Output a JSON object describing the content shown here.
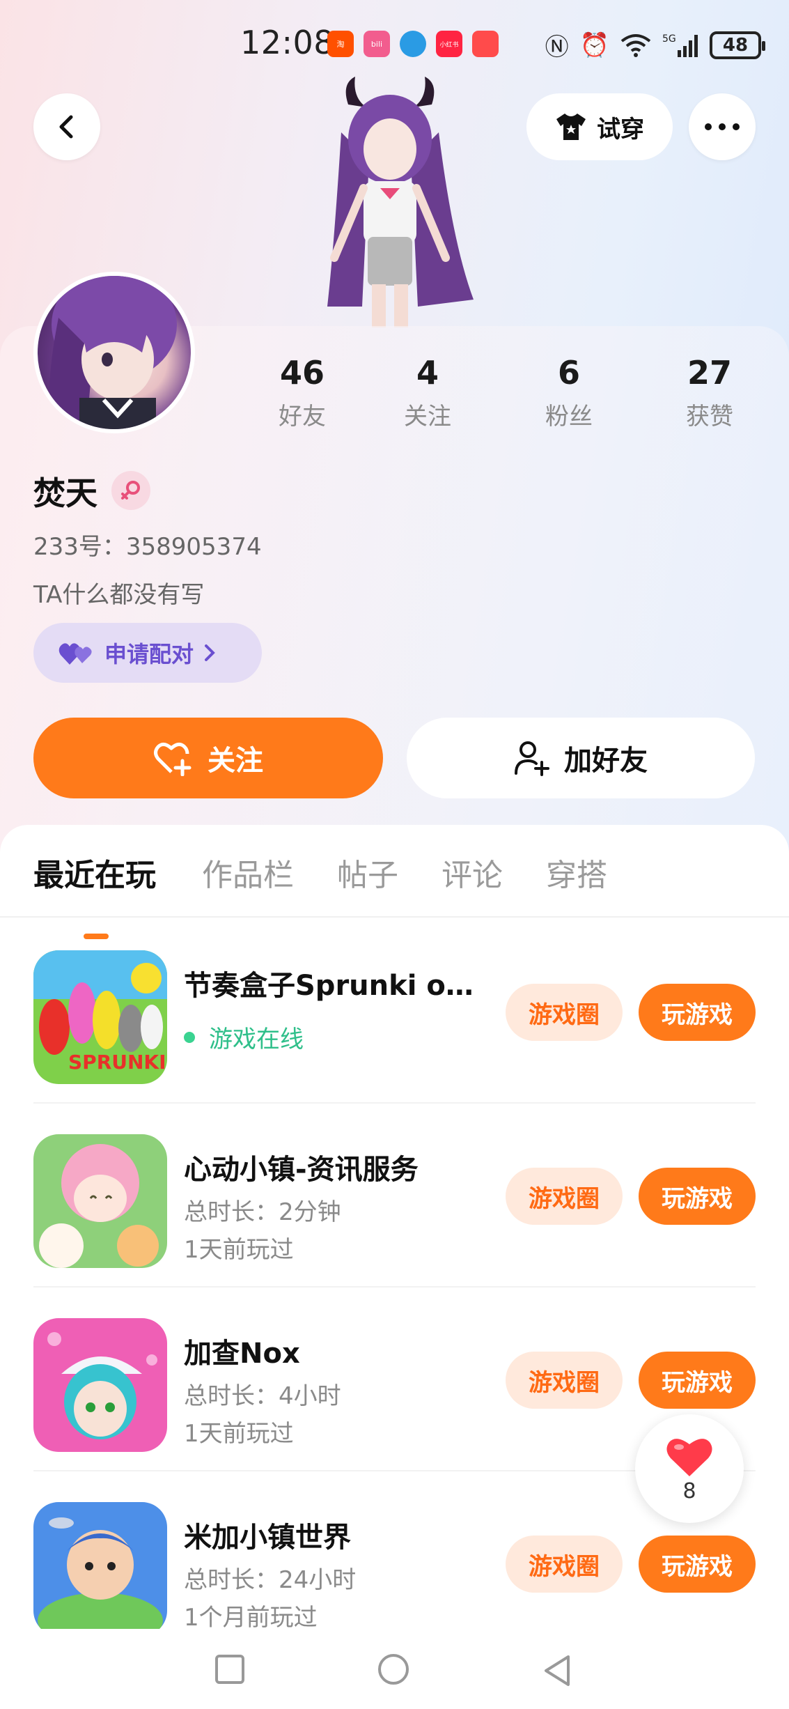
{
  "status_bar": {
    "time": "12:08",
    "apps": [
      {
        "icon": "taobao-app-icon",
        "color": "#ff5000",
        "text": "淘"
      },
      {
        "icon": "bilibili-app-icon",
        "color": "#f25d8e",
        "text": "bili"
      },
      {
        "icon": "circle-app-icon",
        "color": "#2a9be4",
        "text": ""
      },
      {
        "icon": "xiaohongshu-app-icon",
        "color": "#ff2442",
        "text": "小红书"
      },
      {
        "icon": "huawei-app-icon",
        "color": "#ff4b4b",
        "text": ""
      }
    ],
    "battery": "48"
  },
  "header": {
    "try_on_label": "试穿"
  },
  "profile": {
    "stats": [
      {
        "value": "46",
        "label": "好友"
      },
      {
        "value": "4",
        "label": "关注"
      },
      {
        "value": "6",
        "label": "粉丝"
      },
      {
        "value": "27",
        "label": "获赞"
      }
    ],
    "name": "焚天",
    "gender_symbol": "⚲",
    "uid": "233号：358905374",
    "bio": "TA什么都没有写",
    "pair_label": "申请配对"
  },
  "actions": {
    "follow_label": "关注",
    "add_friend_label": "加好友"
  },
  "tabs": [
    "最近在玩",
    "作品栏",
    "帖子",
    "评论",
    "穿搭"
  ],
  "games": [
    {
      "title": "节奏盒子Sprunki op...",
      "status": "游戏在线",
      "online": true,
      "line1": "",
      "line2": "",
      "circle_label": "游戏圈",
      "play_label": "玩游戏"
    },
    {
      "title": "心动小镇-资讯服务",
      "online": false,
      "line1": "总时长：2分钟",
      "line2": "1天前玩过",
      "circle_label": "游戏圈",
      "play_label": "玩游戏"
    },
    {
      "title": "加查Nox",
      "online": false,
      "line1": "总时长：4小时",
      "line2": "1天前玩过",
      "circle_label": "游戏圈",
      "play_label": "玩游戏"
    },
    {
      "title": "米加小镇世界",
      "online": false,
      "line1": "总时长：24小时",
      "line2": "1个月前玩过",
      "circle_label": "游戏圈",
      "play_label": "玩游戏"
    }
  ],
  "like_button": {
    "count": "8"
  },
  "colors": {
    "accent": "#ff7a1a",
    "online": "#2fbf8a",
    "pair": "#6a4fd0"
  }
}
